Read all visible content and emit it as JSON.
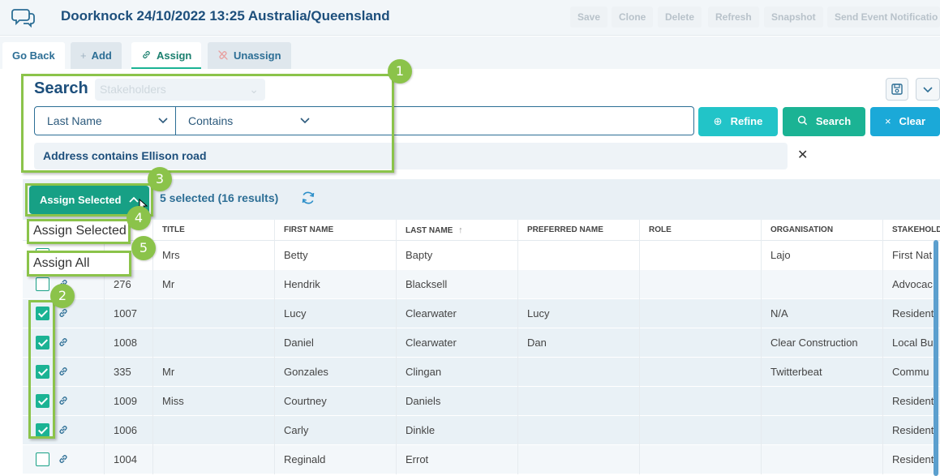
{
  "header": {
    "title": "Doorknock 24/10/2022 13:25 Australia/Queensland",
    "toolbar": {
      "save": "Save",
      "clone": "Clone",
      "delete": "Delete",
      "refresh": "Refresh",
      "snapshot": "Snapshot",
      "send_event": "Send Event Notificatio"
    }
  },
  "tabs": {
    "go_back": "Go Back",
    "add": "Add",
    "assign": "Assign",
    "unassign": "Unassign"
  },
  "search": {
    "title": "Search",
    "type_select": "Stakeholders",
    "field_select": "Last Name",
    "operator_select": "Contains",
    "input_value": "",
    "refine_label": "Refine",
    "search_label": "Search",
    "clear_label": "Clear",
    "active_filter": "Address contains Ellison road"
  },
  "results": {
    "assign_button": "Assign Selected",
    "selected_text": "5 selected (16 results)",
    "menu": {
      "assign_selected": "Assign Selected",
      "assign_all": "Assign All"
    }
  },
  "table": {
    "columns": {
      "title": "TITLE",
      "first_name": "FIRST NAME",
      "last_name": "LAST NAME",
      "preferred_name": "PREFERRED NAME",
      "role": "ROLE",
      "organisation": "ORGANISATION",
      "stakeholder": "STAKEHOLD"
    },
    "rows": [
      {
        "id": "",
        "title": "Mrs",
        "first": "Betty",
        "last": "Bapty",
        "preferred": "",
        "role": "",
        "org": "Lajo",
        "type": "First Nat",
        "checked": false
      },
      {
        "id": "276",
        "title": "Mr",
        "first": "Hendrik",
        "last": "Blacksell",
        "preferred": "",
        "role": "",
        "org": "",
        "type": "Advocac",
        "checked": false
      },
      {
        "id": "1007",
        "title": "",
        "first": "Lucy",
        "last": "Clearwater",
        "preferred": "Lucy",
        "role": "",
        "org": "N/A",
        "type": "Resident",
        "checked": true
      },
      {
        "id": "1008",
        "title": "",
        "first": "Daniel",
        "last": "Clearwater",
        "preferred": "Dan",
        "role": "",
        "org": "Clear Construction",
        "type": "Local Bu",
        "checked": true
      },
      {
        "id": "335",
        "title": "Mr",
        "first": "Gonzales",
        "last": "Clingan",
        "preferred": "",
        "role": "",
        "org": "Twitterbeat",
        "type": "Commu",
        "checked": true
      },
      {
        "id": "1009",
        "title": "Miss",
        "first": "Courtney",
        "last": "Daniels",
        "preferred": "",
        "role": "",
        "org": "",
        "type": "Resident",
        "checked": true
      },
      {
        "id": "1006",
        "title": "",
        "first": "Carly",
        "last": "Dinkle",
        "preferred": "",
        "role": "",
        "org": "",
        "type": "Resident",
        "checked": true
      },
      {
        "id": "1004",
        "title": "",
        "first": "Reginald",
        "last": "Errot",
        "preferred": "",
        "role": "",
        "org": "",
        "type": "Resident",
        "checked": false
      }
    ]
  },
  "annotations": {
    "n1": "1",
    "n2": "2",
    "n3": "3",
    "n4": "4",
    "n5": "5"
  },
  "colors": {
    "brand": "#1d4f7c",
    "green": "#1bb394",
    "teal": "#22c4c8",
    "blue": "#1ba9d8",
    "annotation": "#8bc34a"
  }
}
